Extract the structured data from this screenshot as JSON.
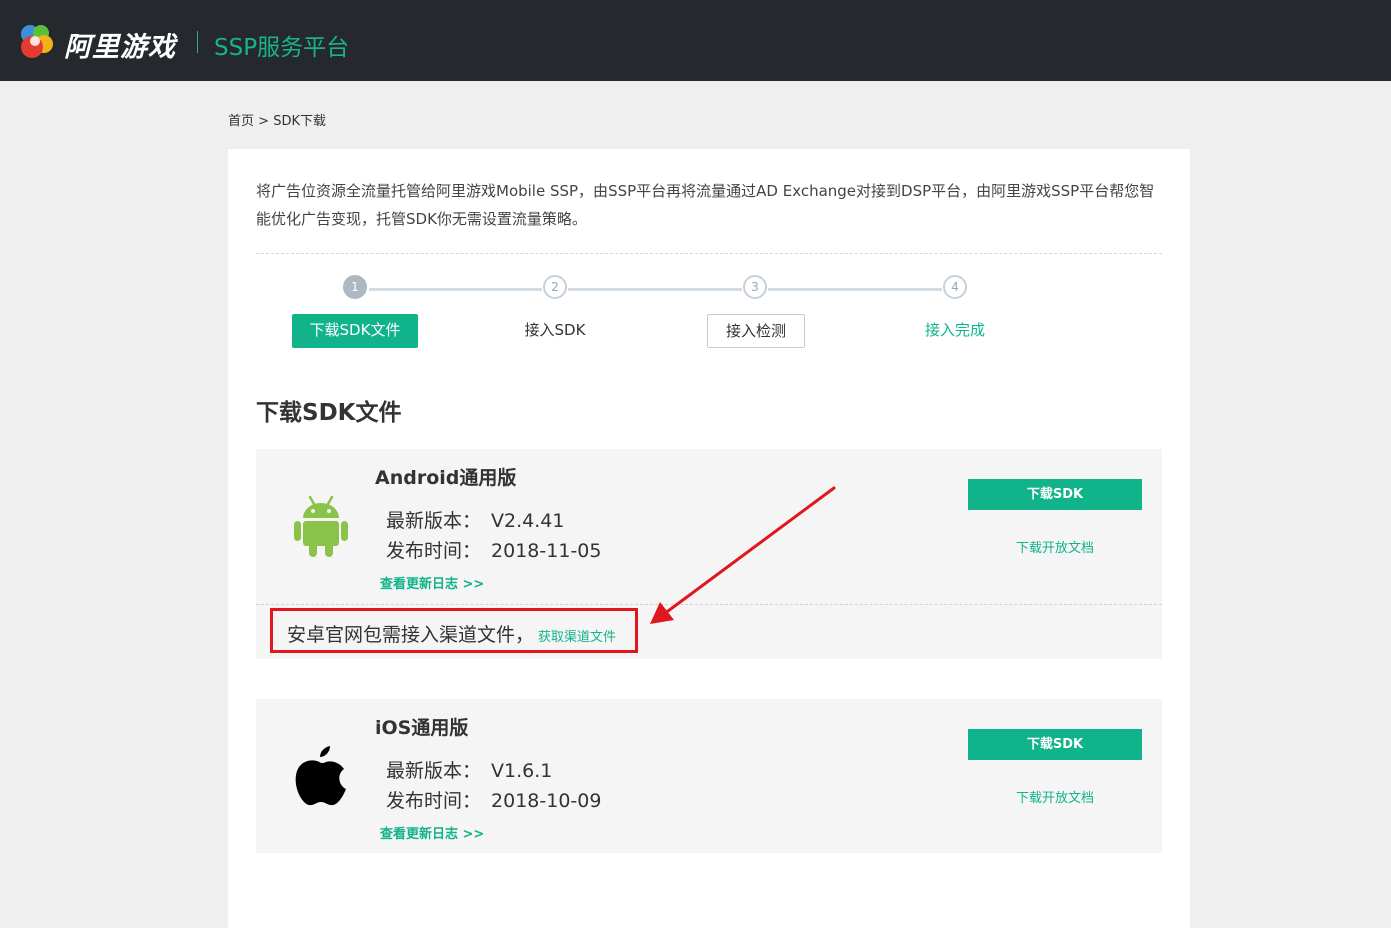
{
  "header": {
    "brand": "阿里游戏",
    "platform": "SSP服务平台",
    "logo_icon": "ali-games-logo-icon",
    "colors": {
      "bar": "#25292d",
      "accent": "#19b38a"
    }
  },
  "breadcrumb": {
    "home": "首页",
    "separator": ">",
    "current": "SDK下载"
  },
  "intro": {
    "text": "将广告位资源全流量托管给阿里游戏Mobile SSP，由SSP平台再将流量通过AD Exchange对接到DSP平台，由阿里游戏SSP平台帮您智能优化广告变现，托管SDK你无需设置流量策略。"
  },
  "steps": [
    {
      "number": "1",
      "label": "下载SDK文件",
      "state": "active"
    },
    {
      "number": "2",
      "label": "接入SDK",
      "state": "plain"
    },
    {
      "number": "3",
      "label": "接入检测",
      "state": "outlined"
    },
    {
      "number": "4",
      "label": "接入完成",
      "state": "done"
    }
  ],
  "section": {
    "title": "下载SDK文件"
  },
  "android": {
    "icon": "android-icon",
    "name": "Android通用版",
    "version_label": "最新版本：",
    "version": "V2.4.41",
    "date_label": "发布时间：",
    "date": "2018-11-05",
    "changelog": "查看更新日志 >>",
    "download_button": "下载SDK",
    "docs_link": "下载开放文档",
    "channel_note": "安卓官网包需接入渠道文件，",
    "channel_link": "获取渠道文件"
  },
  "ios": {
    "icon": "apple-icon",
    "name": "iOS通用版",
    "version_label": "最新版本：",
    "version": "V1.6.1",
    "date_label": "发布时间：",
    "date": "2018-10-09",
    "changelog": "查看更新日志 >>",
    "download_button": "下载SDK",
    "docs_link": "下载开放文档"
  },
  "annotation": {
    "arrow_color": "#e0171e",
    "highlight_color": "#e0171e"
  }
}
